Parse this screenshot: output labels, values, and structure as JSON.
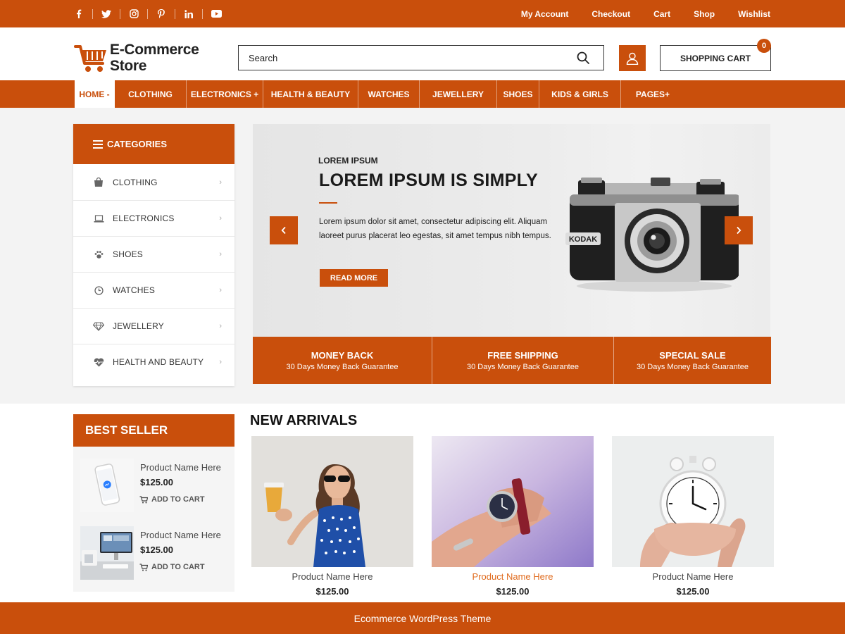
{
  "colors": {
    "brand": "#c94f0c",
    "text": "#222222",
    "highlight": "#e06b1e"
  },
  "topbar": {
    "social": [
      "facebook-icon",
      "twitter-icon",
      "instagram-icon",
      "pinterest-icon",
      "linkedin-icon",
      "youtube-icon"
    ],
    "links": [
      "My Account",
      "Checkout",
      "Cart",
      "Shop",
      "Wishlist"
    ]
  },
  "header": {
    "logo_line1": "E-Commerce",
    "logo_line2": "Store",
    "search_placeholder": "Search",
    "cart_label": "SHOPPING CART",
    "cart_count": "0"
  },
  "nav": {
    "items": [
      "HOME -",
      "CLOTHING",
      "ELECTRONICS +",
      "HEALTH & BEAUTY",
      "WATCHES",
      "JEWELLERY",
      "SHOES",
      "KIDS & GIRLS",
      "PAGES+"
    ],
    "active_index": 0
  },
  "categories": {
    "title": "CATEGORIES",
    "items": [
      {
        "label": "CLOTHING",
        "icon": "shopping-bag-icon"
      },
      {
        "label": "ELECTRONICS",
        "icon": "laptop-icon"
      },
      {
        "label": "SHOES",
        "icon": "paw-icon"
      },
      {
        "label": "WATCHES",
        "icon": "clock-icon"
      },
      {
        "label": "JEWELLERY",
        "icon": "diamond-icon"
      },
      {
        "label": "HEALTH AND BEAUTY",
        "icon": "heartbeat-icon"
      }
    ]
  },
  "slider": {
    "kicker": "LOREM IPSUM",
    "title": "LOREM IPSUM IS SIMPLY",
    "text": "Lorem ipsum dolor sit amet, consectetur adipiscing elit. Aliquam laoreet purus placerat leo egestas, sit amet tempus nibh tempus.",
    "button": "READ MORE",
    "camera_brand": "KODAK"
  },
  "features": [
    {
      "title": "MONEY BACK",
      "subtitle": "30 Days Money Back Guarantee"
    },
    {
      "title": "FREE SHIPPING",
      "subtitle": "30 Days Money Back Guarantee"
    },
    {
      "title": "SPECIAL SALE",
      "subtitle": "30 Days Money Back Guarantee"
    }
  ],
  "best_seller": {
    "title": "BEST SELLER",
    "items": [
      {
        "name": "Product Name Here",
        "price": "$125.00",
        "cta": "ADD TO CART"
      },
      {
        "name": "Product Name Here",
        "price": "$125.00",
        "cta": "ADD TO CART"
      }
    ]
  },
  "new_arrivals": {
    "title": "NEW ARRIVALS",
    "products": [
      {
        "name": "Product Name Here",
        "price": "$125.00"
      },
      {
        "name": "Product Name Here",
        "price": "$125.00"
      },
      {
        "name": "Product Name Here",
        "price": "$125.00"
      }
    ]
  },
  "footer": {
    "text": "Ecommerce WordPress Theme"
  }
}
